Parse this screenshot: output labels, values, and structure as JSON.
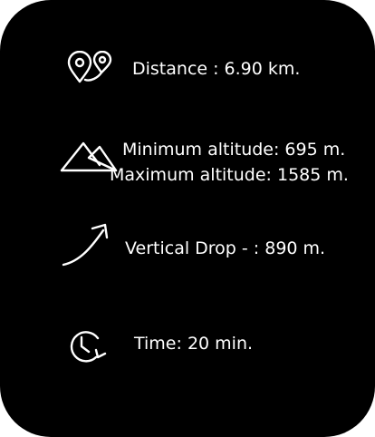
{
  "stats": {
    "distance": {
      "icon": "map-pins-icon",
      "text": "Distance : 6.90 km."
    },
    "altitude": {
      "icon": "mountains-icon",
      "min_text": "Minimum altitude: 695 m.",
      "max_text": "Maximum altitude: 1585 m."
    },
    "vertical_drop": {
      "icon": "ascending-arrow-icon",
      "text": "Vertical Drop - : 890 m."
    },
    "time": {
      "icon": "clock-refresh-icon",
      "text": "Time: 20 min."
    }
  },
  "colors": {
    "background": "#000000",
    "foreground": "#ffffff"
  }
}
